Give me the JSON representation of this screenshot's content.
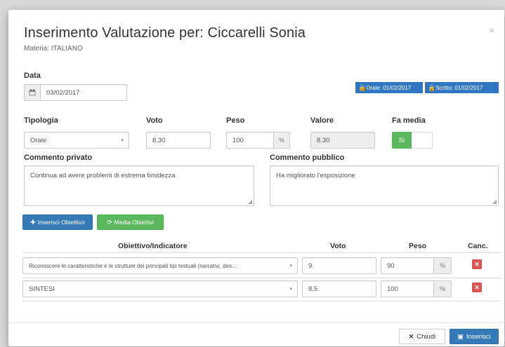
{
  "modal": {
    "title": "Inserimento Valutazione per: Ciccarelli Sonia",
    "subtitle": "Materia: ITALIANO",
    "close_glyph": "×"
  },
  "date": {
    "label": "Data",
    "value": "03/02/2017",
    "icon": "calendar-icon"
  },
  "tags": {
    "orale": "Orale: 01/02/2017",
    "scritto": "Scritto: 01/02/2017"
  },
  "form": {
    "tipologia_label": "Tipologia",
    "tipologia_value": "Orale",
    "voto_label": "Voto",
    "voto_value": "8.30",
    "peso_label": "Peso",
    "peso_value": "100",
    "peso_unit": "%",
    "valore_label": "Valore",
    "valore_value": "8.30",
    "fa_media_label": "Fa media",
    "fa_media_on": "Sì"
  },
  "comments": {
    "privato_label": "Commento privato",
    "privato_value": "Continua ad avere problemi di estrema timidezza",
    "pubblico_label": "Commento pubblico",
    "pubblico_value": "Ha migliorato l'esposizione"
  },
  "actions": {
    "inserisci_obiettivo": "Inserisci Obiettivo",
    "media_obiettivi": "Media Obiettivi"
  },
  "table": {
    "headers": [
      "Obiettivo/Indicatore",
      "Voto",
      "Peso",
      "Canc."
    ],
    "rows": [
      {
        "obiettivo": "Riconoscere le caratteristiche e le strutture dei principali tipi testuali (narrativi, des…",
        "voto": "9",
        "peso": "90",
        "unit": "%"
      },
      {
        "obiettivo": "SINTESI",
        "voto": "8.5",
        "peso": "100",
        "unit": "%"
      }
    ]
  },
  "footer": {
    "close": "Chiudi",
    "insert": "Inserisci"
  },
  "colors": {
    "primary": "#337ab7",
    "success": "#5cb85c",
    "danger": "#d9534f"
  }
}
